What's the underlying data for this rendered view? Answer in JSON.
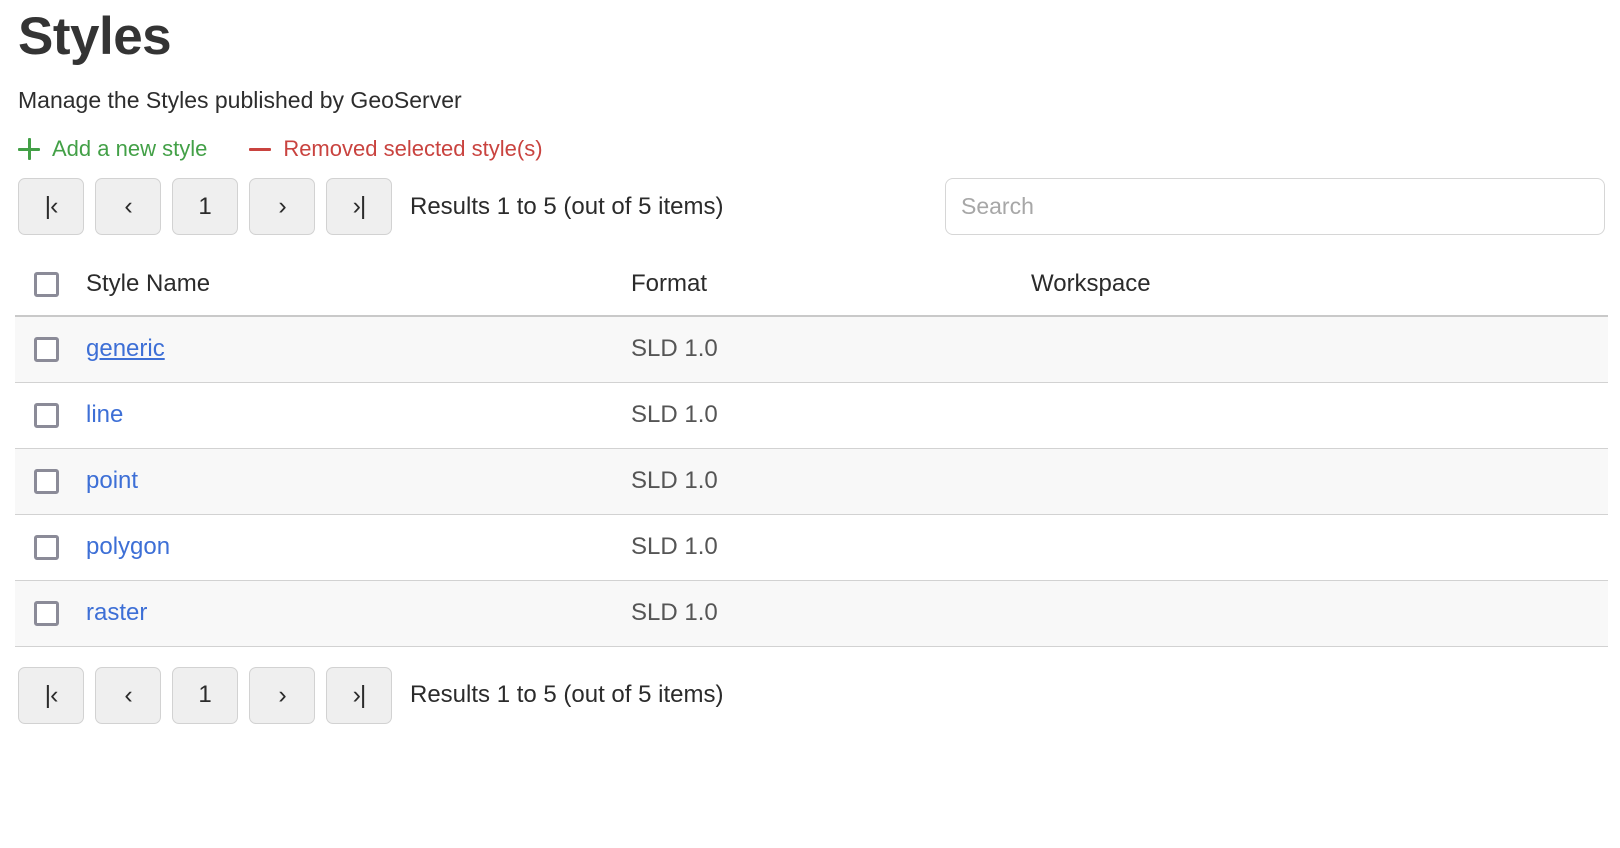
{
  "header": {
    "title": "Styles",
    "subtitle": "Manage the Styles published by GeoServer"
  },
  "toolbar": {
    "add_label": "Add a new style",
    "add_icon": "plus-icon",
    "add_color": "#43a047",
    "remove_label": "Removed selected style(s)",
    "remove_icon": "minus-icon",
    "remove_color": "#c9433f"
  },
  "pager_top": {
    "first_label": "|‹",
    "prev_label": "‹",
    "page_label": "1",
    "next_label": "›",
    "last_label": "›|",
    "status": "Results 1 to 5 (out of 5 items)"
  },
  "pager_bottom": {
    "first_label": "|‹",
    "prev_label": "‹",
    "page_label": "1",
    "next_label": "›",
    "last_label": "›|",
    "status": "Results 1 to 5 (out of 5 items)"
  },
  "search": {
    "placeholder": "Search",
    "value": ""
  },
  "table": {
    "columns": [
      {
        "key": "select",
        "label": ""
      },
      {
        "key": "name",
        "label": "Style Name"
      },
      {
        "key": "format",
        "label": "Format"
      },
      {
        "key": "workspace",
        "label": "Workspace"
      }
    ],
    "rows": [
      {
        "name": "generic",
        "format": "SLD 1.0",
        "workspace": "",
        "selected": false,
        "hovered": true
      },
      {
        "name": "line",
        "format": "SLD 1.0",
        "workspace": "",
        "selected": false,
        "hovered": false
      },
      {
        "name": "point",
        "format": "SLD 1.0",
        "workspace": "",
        "selected": false,
        "hovered": false
      },
      {
        "name": "polygon",
        "format": "SLD 1.0",
        "workspace": "",
        "selected": false,
        "hovered": false
      },
      {
        "name": "raster",
        "format": "SLD 1.0",
        "workspace": "",
        "selected": false,
        "hovered": false
      }
    ]
  },
  "colors": {
    "link": "#3d6fd6",
    "add": "#43a047",
    "remove": "#c9433f",
    "row_alt": "#f8f8f8"
  }
}
